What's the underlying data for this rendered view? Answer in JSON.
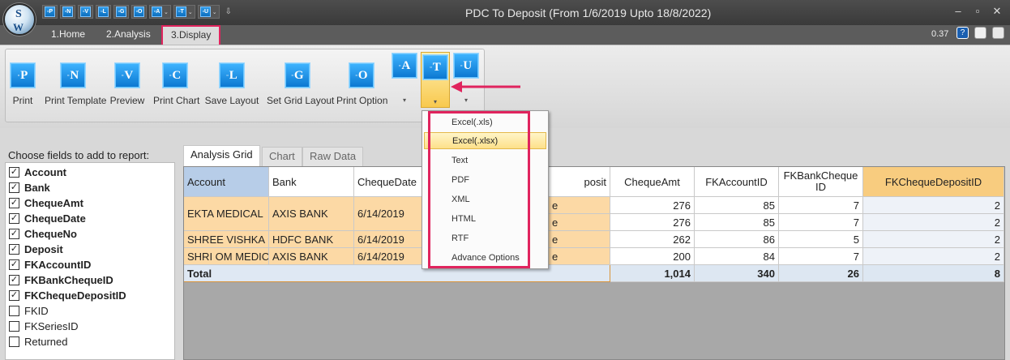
{
  "app": {
    "title": "PDC To Deposit (From 1/6/2019 Upto 18/8/2022)",
    "zoom": "0.37",
    "orb_letters": [
      "S",
      "W"
    ]
  },
  "qat": [
    "P",
    "N",
    "V",
    "L",
    "G",
    "O",
    "A",
    "T",
    "U"
  ],
  "ribbon_tabs": [
    {
      "label": "1.Home"
    },
    {
      "label": "2.Analysis"
    },
    {
      "label": "3.Display",
      "active": true
    }
  ],
  "ribbon_buttons": [
    {
      "icon": "P",
      "label": "Print"
    },
    {
      "icon": "N",
      "label": "Print Template"
    },
    {
      "icon": "V",
      "label": "Preview"
    },
    {
      "icon": "C",
      "label": "Print Chart"
    },
    {
      "icon": "L",
      "label": "Save Layout"
    },
    {
      "icon": "G",
      "label": "Set Grid Layout"
    },
    {
      "icon": "O",
      "label": "Print Option"
    }
  ],
  "split_buttons": [
    {
      "icon": "A"
    },
    {
      "icon": "T",
      "active": true
    },
    {
      "icon": "U"
    }
  ],
  "export_menu": [
    "Excel(.xls)",
    "Excel(.xlsx)",
    "Text",
    "PDF",
    "XML",
    "HTML",
    "RTF",
    "Advance Options"
  ],
  "export_menu_selected": "Excel(.xlsx)",
  "fields_panel": {
    "heading": "Choose fields to add to report:",
    "items": [
      {
        "label": "Account",
        "checked": true
      },
      {
        "label": "Bank",
        "checked": true
      },
      {
        "label": "ChequeAmt",
        "checked": true
      },
      {
        "label": "ChequeDate",
        "checked": true
      },
      {
        "label": "ChequeNo",
        "checked": true
      },
      {
        "label": "Deposit",
        "checked": true
      },
      {
        "label": "FKAccountID",
        "checked": true
      },
      {
        "label": "FKBankChequeID",
        "checked": true
      },
      {
        "label": "FKChequeDepositID",
        "checked": true
      },
      {
        "label": "FKID",
        "checked": false
      },
      {
        "label": "FKSeriesID",
        "checked": false
      },
      {
        "label": "Returned",
        "checked": false
      }
    ]
  },
  "grid_tabs": [
    {
      "label": "Analysis Grid",
      "active": true
    },
    {
      "label": "Chart"
    },
    {
      "label": "Raw Data"
    }
  ],
  "grid": {
    "headers": {
      "account": "Account",
      "bank": "Bank",
      "chequedate": "ChequeDate",
      "deposit_partial": "posit",
      "chequeamt": "ChequeAmt",
      "fkaccountid": "FKAccountID",
      "fkbankchequeid": "FKBankCheque ID",
      "fkchequedepositid": "FKChequeDepositID"
    },
    "groups": [
      {
        "account": "EKTA MEDICAL",
        "bank": "AXIS BANK",
        "date": "6/14/2019"
      },
      {
        "account": "SHREE VISHKA",
        "bank": "HDFC BANK",
        "date": "6/14/2019"
      },
      {
        "account": "SHRI OM MEDIC",
        "bank": "AXIS BANK",
        "date": "6/14/2019"
      }
    ],
    "rows": [
      {
        "deposit": "e",
        "amt": "276",
        "acc": "85",
        "bank": "7",
        "dep": "2"
      },
      {
        "deposit": "e",
        "amt": "276",
        "acc": "85",
        "bank": "7",
        "dep": "2"
      },
      {
        "deposit": "e",
        "amt": "262",
        "acc": "86",
        "bank": "5",
        "dep": "2"
      },
      {
        "deposit": "e",
        "amt": "200",
        "acc": "84",
        "bank": "7",
        "dep": "2"
      }
    ],
    "total": {
      "label": "Total",
      "amt": "1,014",
      "acc": "340",
      "bank": "26",
      "dep": "8"
    }
  }
}
